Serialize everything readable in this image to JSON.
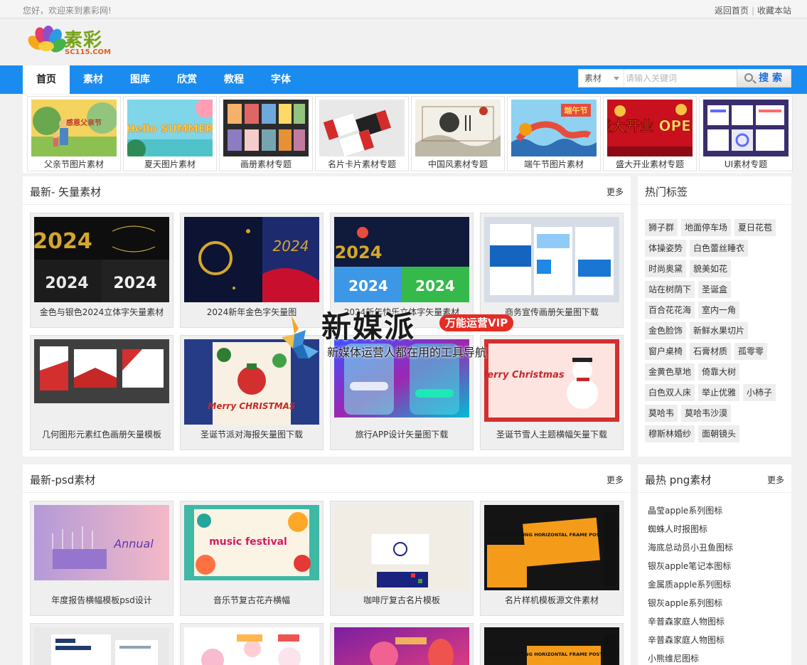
{
  "topbar": {
    "welcome": "您好，欢迎来到素彩网!",
    "home_link": "返回首页",
    "separator": "|",
    "bookmark_link": "收藏本站"
  },
  "logo": {
    "brand": "素彩",
    "domain": "SC115.COM"
  },
  "nav": {
    "items": [
      "首页",
      "素材",
      "图库",
      "欣赏",
      "教程",
      "字体"
    ],
    "active": "首页"
  },
  "search": {
    "category": "素材",
    "placeholder": "请输入关键词",
    "button": "搜 索"
  },
  "topics": [
    "父亲节图片素材",
    "夏天图片素材",
    "画册素材专题",
    "名片卡片素材专题",
    "中国风素材专题",
    "端午节图片素材",
    "盛大开业素材专题",
    "UI素材专题"
  ],
  "vector_panel": {
    "title": "最新- 矢量素材",
    "more": "更多",
    "items": [
      "金色与银色2024立体字矢量素材",
      "2024新年金色字矢量图",
      "2024新年快乐立体字矢量素材",
      "商务宣传画册矢量图下载",
      "几何图形元素红色画册矢量模板",
      "圣诞节派对海报矢量图下载",
      "旅行APP设计矢量图下载",
      "圣诞节雪人主题横幅矢量下载"
    ]
  },
  "tags_panel": {
    "title": "热门标签",
    "tags": [
      "狮子群",
      "地面停车场",
      "夏日花苞",
      "体操姿势",
      "白色蕾丝睡衣",
      "时尚奥黛",
      "貌美如花",
      "站在树荫下",
      "圣诞盒",
      "百合花花海",
      "室内一角",
      "金色脸饰",
      "新鲜水果切片",
      "窗户桌椅",
      "石膏材质",
      "孤零零",
      "金黄色草地",
      "倚靠大树",
      "白色双人床",
      "举止优雅",
      "小柿子",
      "莫哈韦",
      "莫哈韦沙漠",
      "穆斯林婚纱",
      "面朝镜头"
    ]
  },
  "psd_panel": {
    "title": "最新-psd素材",
    "more": "更多",
    "items": [
      "年度报告横幅模板psd设计",
      "音乐节复古花卉横幅",
      "咖啡厅复古名片模板",
      "名片样机模板源文件素材"
    ]
  },
  "png_panel": {
    "title": "最热 png素材",
    "more": "更多",
    "items": [
      "晶莹apple系列图标",
      "蜘蛛人时报图标",
      "海底总动员小丑鱼图标",
      "银灰apple笔记本图标",
      "金属质apple系列图标",
      "银灰apple系列图标",
      "辛普森家庭人物图标",
      "辛普森家庭人物图标",
      "小熊维尼图标"
    ]
  },
  "watermark": {
    "brand": "新媒派",
    "badge": "万能运营VIP",
    "slogan": "新媒体运营人都在用的工具导航"
  },
  "image_text": {
    "father": "感恩父亲节",
    "summer": "Hello SUMMER",
    "dragon": "端午节",
    "opening": "盛大开业 OPEN",
    "n2024": "2024",
    "christmas": "Merry CHRISTMAS",
    "merry": "Merry Christmas",
    "annual": "Annual",
    "music": "music festival",
    "black": "BLACK FLOATING HORIZONTAL FRAME POSTER MOCKUP"
  }
}
